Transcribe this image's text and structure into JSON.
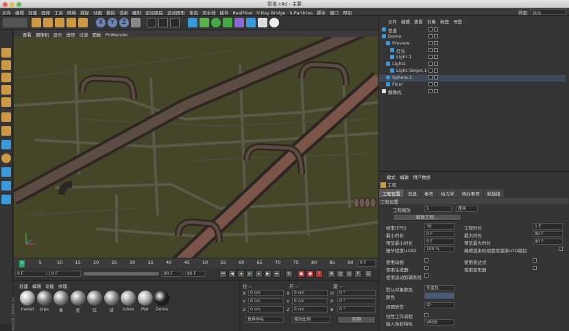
{
  "window": {
    "title": "管道.c4d - 主要"
  },
  "menu": [
    "文件",
    "编辑",
    "创建",
    "选择",
    "工具",
    "网格",
    "捕捉",
    "动画",
    "模拟",
    "渲染",
    "雕刻",
    "运动跟踪",
    "运动图形",
    "角色",
    "流水线",
    "插件",
    "RealFlow",
    "V-Ray Bridge",
    "X-Particles",
    "脚本",
    "窗口",
    "帮助"
  ],
  "interface": {
    "label": "界面:",
    "value": "启动"
  },
  "viewport_menu": [
    "查看",
    "摄像机",
    "显示",
    "选项",
    "过滤",
    "面板",
    "ProRender"
  ],
  "timeline": {
    "ticks": [
      "0",
      "5",
      "10",
      "15",
      "20",
      "25",
      "30",
      "35",
      "40",
      "45",
      "50",
      "55",
      "60",
      "65",
      "70",
      "75",
      "80",
      "85",
      "90"
    ],
    "frame": "0 F"
  },
  "playbar": {
    "start": "0 F",
    "current": "0 F",
    "end": "90 F",
    "end2": "90 F"
  },
  "materials": {
    "menu": [
      "创建",
      "编辑",
      "功能",
      "纹理"
    ],
    "items": [
      {
        "name": "metall",
        "color": "#b8b8b8"
      },
      {
        "name": "pipe",
        "color": "#7a7a7a"
      },
      {
        "name": "黄",
        "color": "#888"
      },
      {
        "name": "蓝",
        "color": "#888"
      },
      {
        "name": "红",
        "color": "#888"
      },
      {
        "name": "绿",
        "color": "#888"
      },
      {
        "name": "tubes",
        "color": "#999"
      },
      {
        "name": "Mat",
        "color": "#aaa"
      },
      {
        "name": "Dome",
        "color": "#222"
      }
    ]
  },
  "brand": "MAXON CINEMA 4D",
  "coords": {
    "header": [
      "位 --",
      "尺 --",
      "旋 --"
    ],
    "rows": [
      {
        "a": "X",
        "av": "0 cm",
        "b": "X",
        "bv": "0 cm",
        "c": "H",
        "cv": "0 °"
      },
      {
        "a": "Y",
        "av": "0 cm",
        "b": "Y",
        "bv": "0 cm",
        "c": "P",
        "cv": "0 °"
      },
      {
        "a": "Z",
        "av": "0 cm",
        "b": "Z",
        "bv": "0 cm",
        "c": "B",
        "cv": "0 °"
      }
    ],
    "mode1": "世界坐标",
    "mode2": "相对比例",
    "apply": "应用"
  },
  "objects": {
    "menu": [
      "文件",
      "编辑",
      "查看",
      "对象",
      "标签",
      "书签"
    ],
    "items": [
      "管道",
      "Dome",
      "Preview",
      "灯光",
      "Light.1",
      "Lights",
      "Light.Target.1",
      "Sphere.1",
      "Floor",
      "摄像机"
    ]
  },
  "attributes": {
    "menu": [
      "模式",
      "编辑",
      "用户数据"
    ],
    "title": "工程",
    "tabs": [
      "工程设置",
      "信息",
      "参考",
      "动力学",
      "待办事项",
      "帧插值"
    ],
    "section": "工程设置",
    "scale_label": "工程缩放",
    "scale_value": "1",
    "scale_unit": "厘米",
    "scale_btn": "缩放工程...",
    "left": [
      {
        "l": "帧率(FPS)",
        "v": "30"
      },
      {
        "l": "最小时长",
        "v": "0 F"
      },
      {
        "l": "预览最小时长",
        "v": "0 F"
      },
      {
        "l": "细节程度(LOD)",
        "v": "100 %"
      },
      {
        "l": "使用动画",
        "v": ""
      },
      {
        "l": "使用生成器",
        "v": ""
      },
      {
        "l": "使用运动剪辑系统",
        "v": ""
      }
    ],
    "right": [
      {
        "l": "工程时长",
        "v": "1 F"
      },
      {
        "l": "最大时长",
        "v": "90 F"
      },
      {
        "l": "预览最大时长",
        "v": "90 F"
      },
      {
        "l": "编辑渲染检视使用渲染LOD级别",
        "v": ""
      },
      {
        "l": "使用表达式",
        "v": ""
      },
      {
        "l": "使用变形器",
        "v": ""
      }
    ],
    "def_color_label": "默认对象颜色",
    "def_color_value": "灰蓝色",
    "color_label": "颜色",
    "view_label": "视图修剪",
    "view_value": "中",
    "linear_label": "线性工作流程",
    "input_label": "输入色彩特性",
    "input_value": "sRGB"
  },
  "colors": {
    "accent": "#4a7fb5",
    "pipe": "#6d5548",
    "ground": "#454528"
  }
}
